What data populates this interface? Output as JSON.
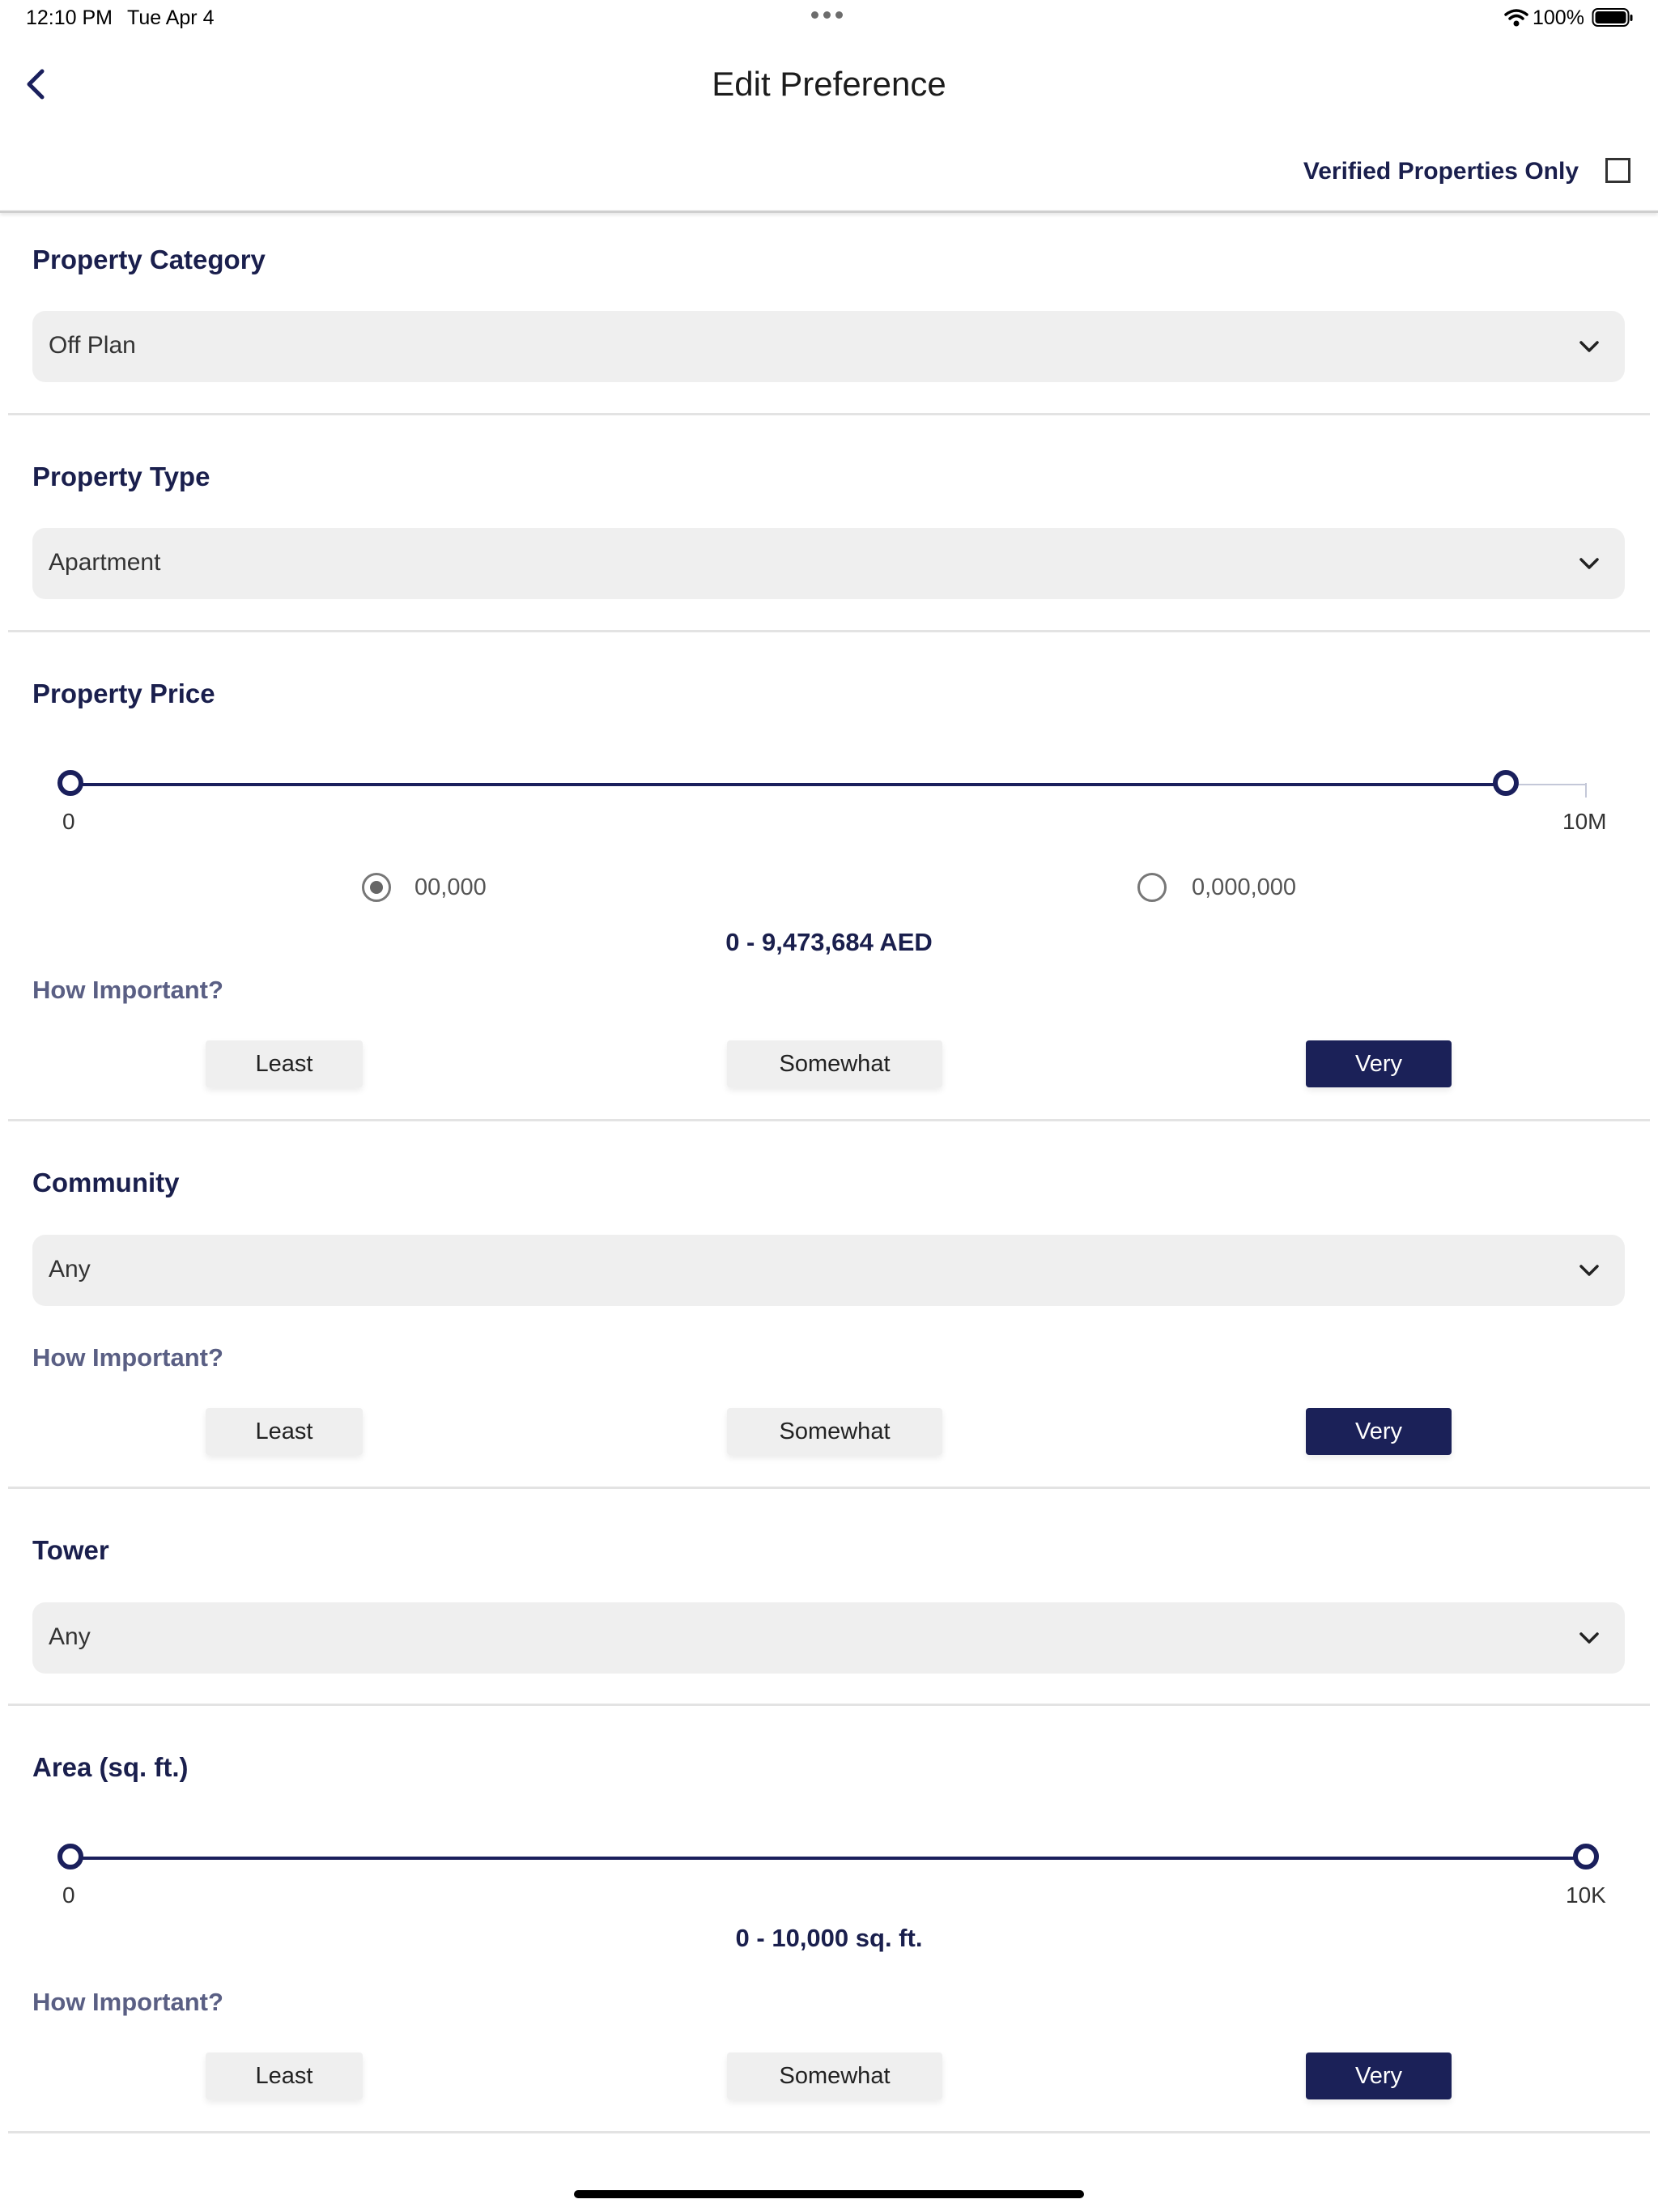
{
  "status_bar": {
    "time": "12:10 PM",
    "date": "Tue Apr 4",
    "battery": "100%"
  },
  "header": {
    "title": "Edit Preference",
    "verified_label": "Verified Properties Only",
    "verified_checked": false
  },
  "category": {
    "title": "Property Category",
    "value": "Off Plan"
  },
  "type": {
    "title": "Property Type",
    "value": "Apartment"
  },
  "price": {
    "title": "Property Price",
    "min_label": "0",
    "max_label": "10M",
    "range_min": 0,
    "range_max": 9473684,
    "scale_max": 10000000,
    "radio1_label": "00,000",
    "radio2_label": "0,000,000",
    "radio_selected": 1,
    "range_text": "0 - 9,473,684 AED",
    "how_label": "How Important?",
    "options": [
      "Least",
      "Somewhat",
      "Very"
    ],
    "selected": "Very"
  },
  "community": {
    "title": "Community",
    "value": "Any",
    "how_label": "How Important?",
    "options": [
      "Least",
      "Somewhat",
      "Very"
    ],
    "selected": "Very"
  },
  "tower": {
    "title": "Tower",
    "value": "Any"
  },
  "area": {
    "title": "Area (sq. ft.)",
    "min_label": "0",
    "max_label": "10K",
    "range_min": 0,
    "range_max": 10000,
    "scale_max": 10000,
    "range_text": "0 - 10,000 sq. ft.",
    "how_label": "How Important?",
    "options": [
      "Least",
      "Somewhat",
      "Very"
    ],
    "selected": "Very"
  },
  "colors": {
    "primary": "#1b2158",
    "dropdown_bg": "#efefef",
    "divider": "#e3e3e3"
  }
}
